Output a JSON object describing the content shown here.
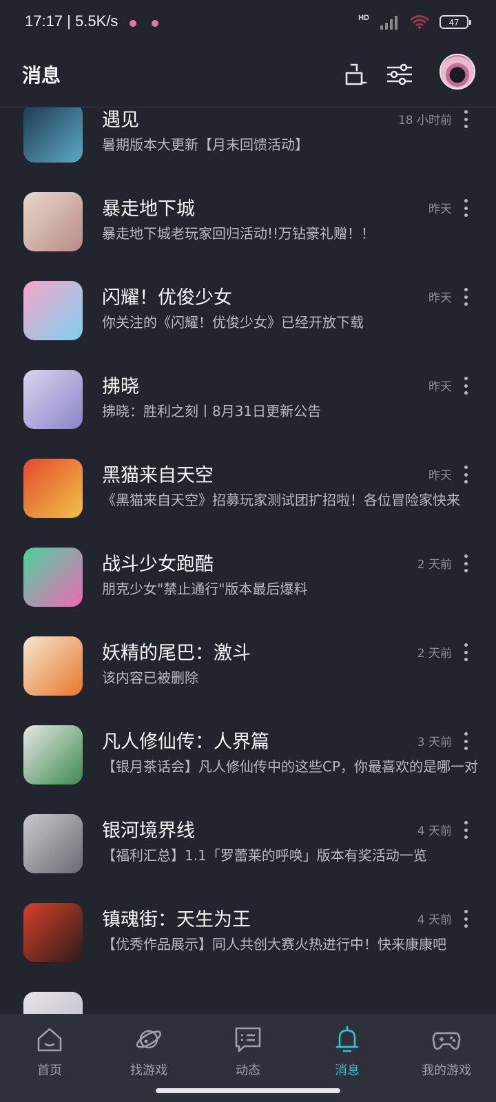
{
  "status_bar": {
    "time": "17:17 | 5.5K/s",
    "network_type": "HD",
    "battery": "47"
  },
  "header": {
    "title": "消息",
    "clean_icon": "broom-icon",
    "filter_icon": "sliders-icon"
  },
  "messages": [
    {
      "title": "遇见",
      "subtitle": "暑期版本大更新【月末回馈活动】",
      "time": "18 小时前",
      "colors": [
        "#1c3a4e",
        "#5ea8c4"
      ]
    },
    {
      "title": "暴走地下城",
      "subtitle": "暴走地下城老玩家回归活动!!万钻豪礼赠！！",
      "time": "昨天",
      "colors": [
        "#e8d9c6",
        "#b98a8a"
      ]
    },
    {
      "title": "闪耀！优俊少女",
      "subtitle": "你关注的《闪耀！优俊少女》已经开放下载",
      "time": "昨天",
      "colors": [
        "#f5a6c8",
        "#7fd0f0"
      ]
    },
    {
      "title": "拂晓",
      "subtitle": "拂晓：胜利之刻丨8月31日更新公告",
      "time": "昨天",
      "colors": [
        "#d8d4f0",
        "#8a86c8"
      ]
    },
    {
      "title": "黑猫来自天空",
      "subtitle": "《黑猫来自天空》招募玩家测试团扩招啦！各位冒险家快来",
      "time": "昨天",
      "colors": [
        "#e24a2e",
        "#f3c14a"
      ]
    },
    {
      "title": "战斗少女跑酷",
      "subtitle": "朋克少女\"禁止通行\"版本最后爆料",
      "time": "2 天前",
      "colors": [
        "#49d2a0",
        "#f06ab0"
      ]
    },
    {
      "title": "妖精的尾巴：激斗",
      "subtitle": "该内容已被删除",
      "time": "2 天前",
      "colors": [
        "#f5e7d0",
        "#e9762c"
      ]
    },
    {
      "title": "凡人修仙传：人界篇",
      "subtitle": "【银月茶话会】凡人修仙传中的这些CP，你最喜欢的是哪一对",
      "time": "3 天前",
      "colors": [
        "#e6e8e4",
        "#3d8a4e"
      ]
    },
    {
      "title": "银河境界线",
      "subtitle": "【福利汇总】1.1「罗蕾莱的呼唤」版本有奖活动一览",
      "time": "4 天前",
      "colors": [
        "#c9c9cf",
        "#6b6a72"
      ]
    },
    {
      "title": "镇魂街：天生为王",
      "subtitle": "【优秀作品展示】同人共创大赛火热进行中！快来康康吧",
      "time": "4 天前",
      "colors": [
        "#d8402a",
        "#2a1c1a"
      ]
    }
  ],
  "tabs": [
    {
      "label": "首页",
      "icon": "home-icon",
      "active": false
    },
    {
      "label": "找游戏",
      "icon": "planet-icon",
      "active": false
    },
    {
      "label": "动态",
      "icon": "chat-icon",
      "active": false
    },
    {
      "label": "消息",
      "icon": "bell-icon",
      "active": true
    },
    {
      "label": "我的游戏",
      "icon": "gamepad-icon",
      "active": false
    }
  ],
  "colors": {
    "background": "#22252e",
    "accent": "#34c2cf",
    "tabbar": "#2e313b"
  }
}
